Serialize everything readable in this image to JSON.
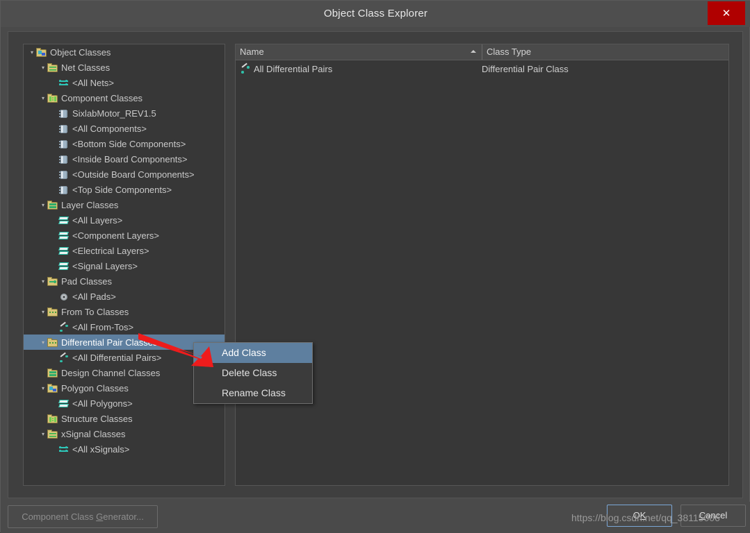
{
  "window": {
    "title": "Object Class Explorer",
    "close_label": "✕"
  },
  "tree": {
    "items": [
      {
        "label": "Object Classes",
        "indent": 0,
        "icon": "folder-polygon-icon",
        "twisty": "expanded",
        "selected": false
      },
      {
        "label": "Net Classes",
        "indent": 1,
        "icon": "folder-net-icon",
        "twisty": "expanded",
        "selected": false
      },
      {
        "label": "<All Nets>",
        "indent": 2,
        "icon": "net-icon",
        "twisty": "none",
        "selected": false
      },
      {
        "label": "Component Classes",
        "indent": 1,
        "icon": "folder-struct-icon",
        "twisty": "expanded",
        "selected": false
      },
      {
        "label": "SixlabMotor_REV1.5",
        "indent": 2,
        "icon": "component-icon",
        "twisty": "none",
        "selected": false
      },
      {
        "label": "<All Components>",
        "indent": 2,
        "icon": "component-icon",
        "twisty": "none",
        "selected": false
      },
      {
        "label": "<Bottom Side Components>",
        "indent": 2,
        "icon": "component-icon",
        "twisty": "none",
        "selected": false
      },
      {
        "label": "<Inside Board Components>",
        "indent": 2,
        "icon": "component-icon",
        "twisty": "none",
        "selected": false
      },
      {
        "label": "<Outside Board Components>",
        "indent": 2,
        "icon": "component-icon",
        "twisty": "none",
        "selected": false
      },
      {
        "label": "<Top Side Components>",
        "indent": 2,
        "icon": "component-icon",
        "twisty": "none",
        "selected": false
      },
      {
        "label": "Layer Classes",
        "indent": 1,
        "icon": "folder-layers-icon",
        "twisty": "expanded",
        "selected": false
      },
      {
        "label": "<All Layers>",
        "indent": 2,
        "icon": "layer-icon",
        "twisty": "none",
        "selected": false
      },
      {
        "label": "<Component Layers>",
        "indent": 2,
        "icon": "layer-icon",
        "twisty": "none",
        "selected": false
      },
      {
        "label": "<Electrical Layers>",
        "indent": 2,
        "icon": "layer-icon",
        "twisty": "none",
        "selected": false
      },
      {
        "label": "<Signal Layers>",
        "indent": 2,
        "icon": "layer-icon",
        "twisty": "none",
        "selected": false
      },
      {
        "label": "Pad Classes",
        "indent": 1,
        "icon": "folder-pad-icon",
        "twisty": "expanded",
        "selected": false
      },
      {
        "label": "<All Pads>",
        "indent": 2,
        "icon": "pad-icon",
        "twisty": "none",
        "selected": false
      },
      {
        "label": "From To Classes",
        "indent": 1,
        "icon": "folder-dots-icon",
        "twisty": "expanded",
        "selected": false
      },
      {
        "label": "<All From-Tos>",
        "indent": 2,
        "icon": "from-to-icon",
        "twisty": "none",
        "selected": false
      },
      {
        "label": "Differential Pair Classes",
        "indent": 1,
        "icon": "folder-dots-icon",
        "twisty": "expanded",
        "selected": true
      },
      {
        "label": "<All Differential Pairs>",
        "indent": 2,
        "icon": "from-to-icon",
        "twisty": "none",
        "selected": false
      },
      {
        "label": "Design Channel Classes",
        "indent": 1,
        "icon": "folder-layers-icon",
        "twisty": "none",
        "selected": false
      },
      {
        "label": "Polygon Classes",
        "indent": 1,
        "icon": "folder-polygon-icon",
        "twisty": "expanded",
        "selected": false
      },
      {
        "label": "<All Polygons>",
        "indent": 2,
        "icon": "layer-icon",
        "twisty": "none",
        "selected": false
      },
      {
        "label": "Structure Classes",
        "indent": 1,
        "icon": "folder-struct-icon",
        "twisty": "none",
        "selected": false
      },
      {
        "label": "xSignal Classes",
        "indent": 1,
        "icon": "folder-net-icon",
        "twisty": "expanded",
        "selected": false
      },
      {
        "label": "<All xSignals>",
        "indent": 2,
        "icon": "net-icon",
        "twisty": "none",
        "selected": false
      }
    ]
  },
  "list": {
    "columns": [
      {
        "label": "Name",
        "sorted": "asc"
      },
      {
        "label": "Class Type",
        "sorted": "none"
      }
    ],
    "rows": [
      {
        "name": "All Differential Pairs",
        "class_type": "Differential Pair Class",
        "icon": "from-to-icon"
      }
    ]
  },
  "context_menu": {
    "items": [
      {
        "label": "Add Class",
        "highlighted": true
      },
      {
        "label": "Delete Class",
        "highlighted": false
      },
      {
        "label": "Rename Class",
        "highlighted": false
      }
    ]
  },
  "footer": {
    "generator_button": "Component Class Generator...",
    "generator_accel": "G",
    "ok_button": "OK",
    "ok_accel": "K",
    "cancel_button": "Cancel",
    "cancel_accel": "C"
  },
  "watermark": {
    "text": "https://blog.csdn.net/qq_38115006"
  },
  "colors": {
    "selection": "#5e7f9f",
    "close_button": "#b00000",
    "annotation_arrow": "#ee1c1c",
    "focus_border": "#7ba7d7"
  }
}
